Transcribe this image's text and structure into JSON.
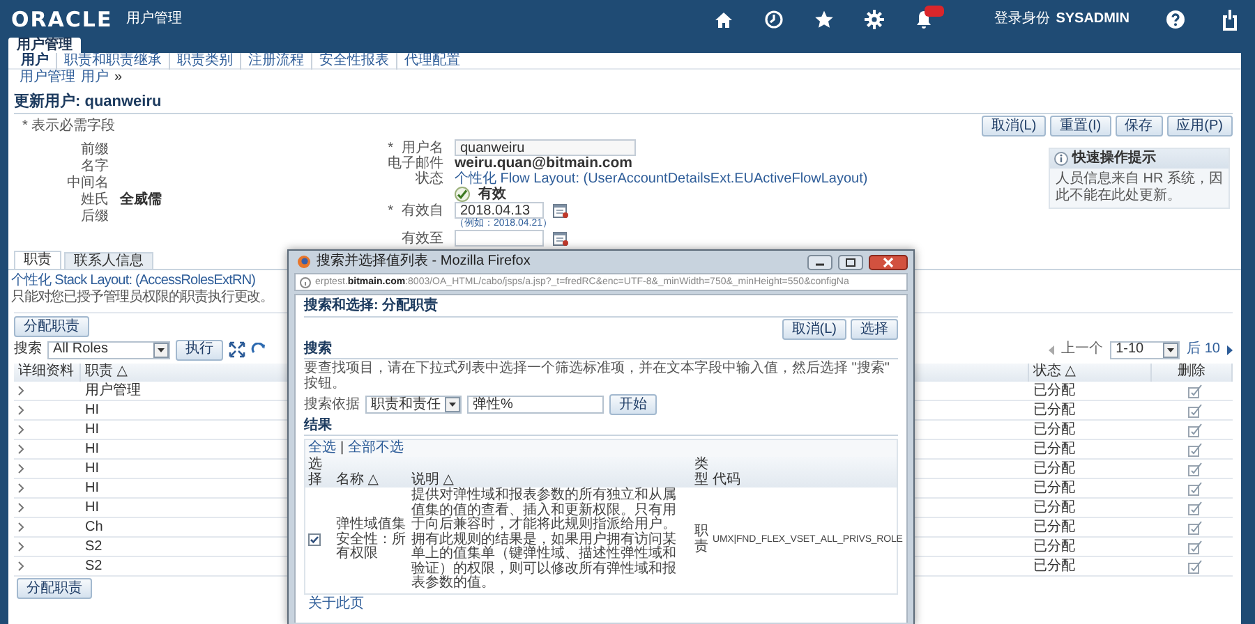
{
  "header": {
    "logo": "ORACLE",
    "app_title": "用户管理",
    "login_label": "登录身份",
    "login_user": "SYSADMIN"
  },
  "top_tabs": [
    {
      "label": "用户管理",
      "selected": true
    }
  ],
  "subnav": [
    {
      "label": "用户",
      "selected": true
    },
    {
      "label": "职责和职责继承",
      "selected": false
    },
    {
      "label": "职责类别",
      "selected": false
    },
    {
      "label": "注册流程",
      "selected": false
    },
    {
      "label": "安全性报表",
      "selected": false
    },
    {
      "label": "代理配置",
      "selected": false
    }
  ],
  "breadcrumbs": [
    "用户管理",
    "用户"
  ],
  "breadcrumb_separator": "»",
  "page_title": "更新用户: quanweiru",
  "required_note": "* 表示必需字段",
  "page_buttons": [
    "取消(L)",
    "重置(I)",
    "保存",
    "应用(P)"
  ],
  "name_fields": [
    {
      "label": "前缀"
    },
    {
      "label": "名字"
    },
    {
      "label": "中间名"
    },
    {
      "label": "姓氏",
      "value": "全威儒"
    },
    {
      "label": "后缀"
    }
  ],
  "account": {
    "username": {
      "label": "用户名",
      "required_mark": "*",
      "value": "quanweiru"
    },
    "email": {
      "label": "电子邮件",
      "value": "weiru.quan@bitmain.com"
    },
    "status": {
      "label": "状态",
      "personalize_link": "个性化 Flow Layout: (UserAccountDetailsExt.EUActiveFlowLayout)",
      "active": {
        "label": "有效",
        "checked": true
      }
    },
    "effective_from": {
      "label": "有效自",
      "required_mark": "*",
      "value": "2018.04.13",
      "hint": "（例如：2018.04.21）"
    },
    "effective_to": {
      "label": "有效至"
    }
  },
  "tip": {
    "title": "快速操作提示",
    "text": "人员信息来自 HR 系统，因此不能在此处更新。"
  },
  "detail_tabs": [
    {
      "label": "职责",
      "selected": true
    },
    {
      "label": "联系人信息",
      "selected": false
    }
  ],
  "roles": {
    "personalize_link": "个性化 Stack Layout: (AccessRolesExtRN)",
    "note": "只能对您已授予管理员权限的职责执行更改。",
    "assign_button": "分配职责",
    "search_label": "搜索",
    "search_value": "All Roles",
    "go_button": "执行",
    "pager": {
      "previous": "上一个",
      "range": "1-10",
      "next": "后 10"
    },
    "columns": [
      "详细资料",
      "职责 △",
      "状态 △",
      "删除"
    ],
    "rows": [
      {
        "role": "用户管理",
        "status": "已分配"
      },
      {
        "role": "HI",
        "status": "已分配"
      },
      {
        "role": "HI",
        "status": "已分配"
      },
      {
        "role": "HI",
        "status": "已分配"
      },
      {
        "role": "HI",
        "status": "已分配"
      },
      {
        "role": "HI",
        "status": "已分配"
      },
      {
        "role": "HI",
        "status": "已分配"
      },
      {
        "role": "Ch",
        "status": "已分配"
      },
      {
        "role": "S2",
        "status": "已分配"
      },
      {
        "role": "S2",
        "status": "已分配"
      }
    ],
    "bottom_button": "分配职责"
  },
  "popup": {
    "window_title": "搜索并选择值列表 - Mozilla Firefox",
    "url": "erptest.**bitmain.com**:8003/OA_HTML/cabo/jsps/a.jsp?_t=fredRC&enc=UTF-8&_minWidth=750&_minHeight=550&configNa",
    "heading": "搜索和选择: 分配职责",
    "buttons": [
      "取消(L)",
      "选择"
    ],
    "search_section": "搜索",
    "instruction": "要查找项目，请在下拉式列表中选择一个筛选标准项，并在文本字段中输入值，然后选择 \"搜索\" 按钮。",
    "search_by_label": "搜索依据",
    "search_by_value": "职责和责任",
    "search_text": "弹性%",
    "go_button": "开始",
    "results_section": "结果",
    "select_all": "全选",
    "select_separator": "|",
    "select_none": "全部不选",
    "columns": [
      "选择",
      "名称 △",
      "说明 △",
      "类型",
      "代码"
    ],
    "rows": [
      {
        "checked": true,
        "name": "弹性域值集安全性：所有权限",
        "description": "提供对弹性域和报表参数的所有独立和从属值集的值的查看、插入和更新权限。只有用于向后兼容时，才能将此规则指派给用户。拥有此规则的结果是，如果用户拥有访问某单上的值集单（键弹性域、描述性弹性域和验证）的权限，则可以修改所有弹性域和报表参数的值。",
        "type": "职责",
        "code": "UMX|FND_FLEX_VSET_ALL_PRIVS_ROLE"
      }
    ],
    "footer_link": "关于此页"
  }
}
